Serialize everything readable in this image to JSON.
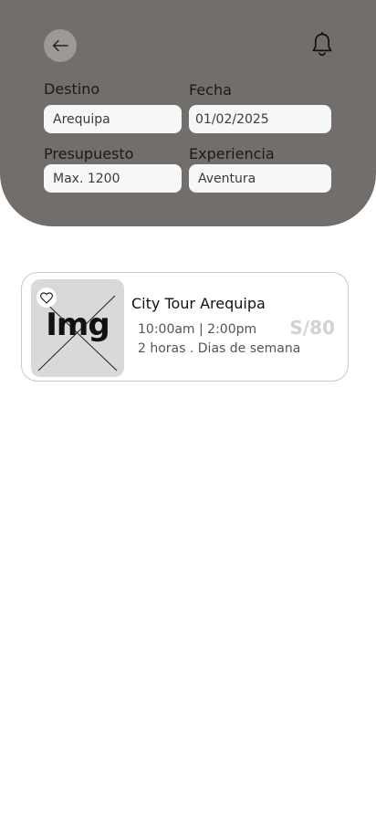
{
  "filters": {
    "destination": {
      "label": "Destino",
      "value": "Arequipa"
    },
    "date": {
      "label": "Fecha",
      "value": "01/02/2025"
    },
    "budget": {
      "label": "Presupuesto",
      "value": "Max. 1200"
    },
    "experience": {
      "label": "Experiencia",
      "value": "Aventura"
    }
  },
  "icons": {
    "back": "arrow-left-icon",
    "notifications": "bell-icon",
    "favorite": "heart-icon"
  },
  "results": [
    {
      "image_placeholder": "Img",
      "title": "City Tour Arequipa",
      "times": "10:00am | 2:00pm",
      "duration": "2 horas . Dias de semana",
      "price": "S/80"
    }
  ],
  "colors": {
    "header_bg": "#726e6c",
    "input_bg": "#f6f7f7",
    "back_button_bg": "#9c9997",
    "price_text": "#d2d2d2"
  }
}
